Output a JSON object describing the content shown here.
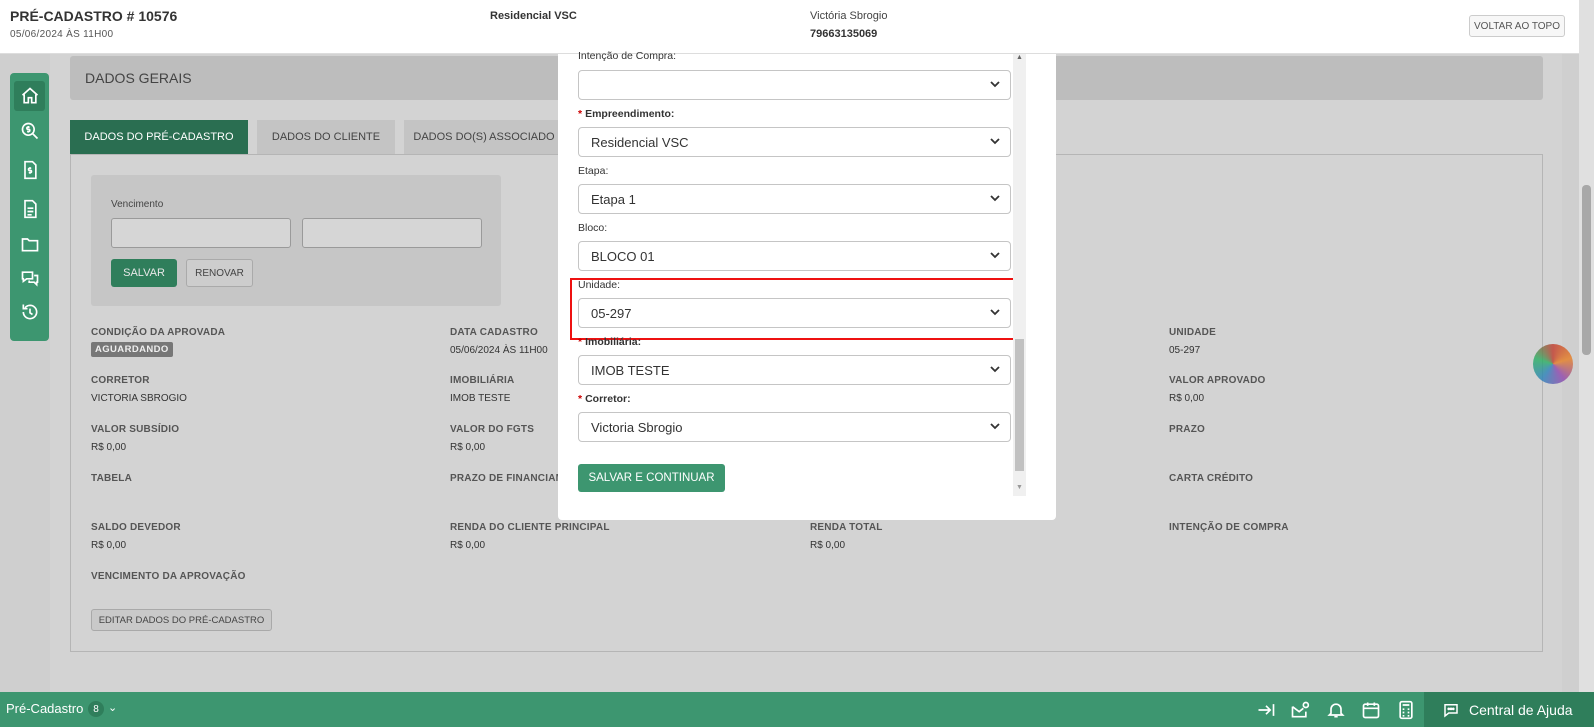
{
  "header": {
    "title": "PRÉ-CADASTRO # 10576",
    "subtitle": "05/06/2024 ÀS 11H00",
    "project": "Residencial VSC",
    "client_name": "Victória Sbrogio",
    "client_code": "79663135069",
    "back_to_top": "VOLTAR AO TOPO"
  },
  "sidenav": {
    "items": [
      "home-icon",
      "search-money-icon",
      "money-doc-icon",
      "document-icon",
      "folder-icon",
      "chat-icon",
      "history-icon"
    ]
  },
  "section": {
    "title": "DADOS GERAIS"
  },
  "tabs": [
    {
      "label": "DADOS DO PRÉ-CADASTRO"
    },
    {
      "label": "DADOS DO CLIENTE"
    },
    {
      "label": "DADOS DO(S) ASSOCIADO"
    }
  ],
  "renewal": {
    "label": "Vencimento",
    "save": "SALVAR",
    "renew": "RENOVAR"
  },
  "fields": {
    "condicao_label": "CONDIÇÃO DA APROVADA",
    "condicao_value": "AGUARDANDO",
    "data_cadastro_label": "DATA CADASTRO",
    "data_cadastro_value": "05/06/2024 ÀS 11H00",
    "unidade_label": "UNIDADE",
    "unidade_value": "05-297",
    "corretor_label": "CORRETOR",
    "corretor_value": "VICTORIA SBROGIO",
    "imobiliaria_label": "IMOBILIÁRIA",
    "imobiliaria_value": "IMOB TESTE",
    "valor_aprovado_label": "VALOR APROVADO",
    "valor_aprovado_value": "R$ 0,00",
    "valor_subsidio_label": "VALOR SUBSÍDIO",
    "valor_subsidio_value": "R$ 0,00",
    "valor_fgts_label": "VALOR DO FGTS",
    "valor_fgts_value": "R$ 0,00",
    "prazo_label": "PRAZO",
    "tabela_label": "TABELA",
    "prazo_financ_label": "PRAZO DE FINANCIAM",
    "carta_credito_label": "CARTA CRÉDITO",
    "saldo_devedor_label": "SALDO DEVEDOR",
    "saldo_devedor_value": "R$ 0,00",
    "renda_cliente_label": "RENDA DO CLIENTE PRINCIPAL",
    "renda_cliente_value": "R$ 0,00",
    "renda_total_label": "RENDA TOTAL",
    "renda_total_value": "R$ 0,00",
    "intencao_compra_label": "INTENÇÃO DE COMPRA",
    "vencimento_aprov_label": "VENCIMENTO DA APROVAÇÃO",
    "edit_button": "EDITAR DADOS DO PRÉ-CADASTRO"
  },
  "modal": {
    "intencao_label": "Intenção de Compra:",
    "intencao_value": "",
    "empreendimento_label": "Empreendimento:",
    "empreendimento_value": "Residencial VSC",
    "etapa_label": "Etapa:",
    "etapa_value": "Etapa 1",
    "bloco_label": "Bloco:",
    "bloco_value": "BLOCO 01",
    "unidade_label": "Unidade:",
    "unidade_value": "05-297",
    "imobiliaria_label": "Imobiliária:",
    "imobiliaria_value": "IMOB TESTE",
    "corretor_label": "Corretor:",
    "corretor_value": "Victoria Sbrogio",
    "save_continue": "SALVAR E CONTINUAR",
    "required_mark": "*"
  },
  "bottombar": {
    "module": "Pré-Cadastro",
    "count": "8",
    "help": "Central de Ajuda"
  },
  "colors": {
    "brand_green": "#3d9670",
    "dark_green": "#2f7e5b",
    "highlight_red": "#e11111"
  }
}
